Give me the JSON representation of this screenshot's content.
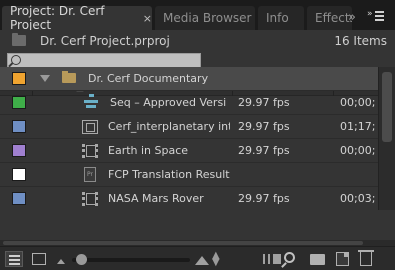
{
  "tabs": [
    {
      "label": "Project: Dr. Cerf Project",
      "close": "×",
      "active": true
    },
    {
      "label": "Media Browser",
      "active": false
    },
    {
      "label": "Info",
      "active": false
    },
    {
      "label": "Effects",
      "active": false
    }
  ],
  "tab_overflow": "»",
  "project": {
    "file_name": "Dr. Cerf Project.prproj",
    "item_count": "16 Items"
  },
  "search": {
    "value": "",
    "placeholder": ""
  },
  "columns": {
    "name": "Name",
    "frame_rate": "Frame Rate",
    "media_start": "Media Sta"
  },
  "rows": [
    {
      "name": "Dr. Cerf Documentary",
      "label_color": "#f0a430",
      "icon": "folder-icon",
      "frame_rate": "",
      "media_start": "",
      "expanded": true
    },
    {
      "name": "Seq – Approved Versi",
      "label_color": "#3fae49",
      "icon": "sequence-icon",
      "frame_rate": "29.97 fps",
      "media_start": "00;00;"
    },
    {
      "name": "Cerf_interplanetary int",
      "label_color": "#6f8fc4",
      "icon": "video-clip-icon",
      "frame_rate": "29.97 fps",
      "media_start": "01;17;"
    },
    {
      "name": "Earth in Space",
      "label_color": "#a080d0",
      "icon": "film-clip-icon",
      "frame_rate": "29.97 fps",
      "media_start": "00;00;"
    },
    {
      "name": "FCP Translation Result",
      "label_color": "#ffffff",
      "icon": "document-icon",
      "frame_rate": "",
      "media_start": ""
    },
    {
      "name": "NASA Mars Rover",
      "label_color": "#6f8fc4",
      "icon": "film-clip-icon",
      "frame_rate": "29.97 fps",
      "media_start": "00;03;"
    }
  ],
  "document_icon_text": "Pr",
  "colors": {
    "panel_bg": "#343434",
    "tabbar_bg": "#1b1b1b",
    "selected_row": "#4a4a4a",
    "search_bg": "#bfbfbf"
  }
}
